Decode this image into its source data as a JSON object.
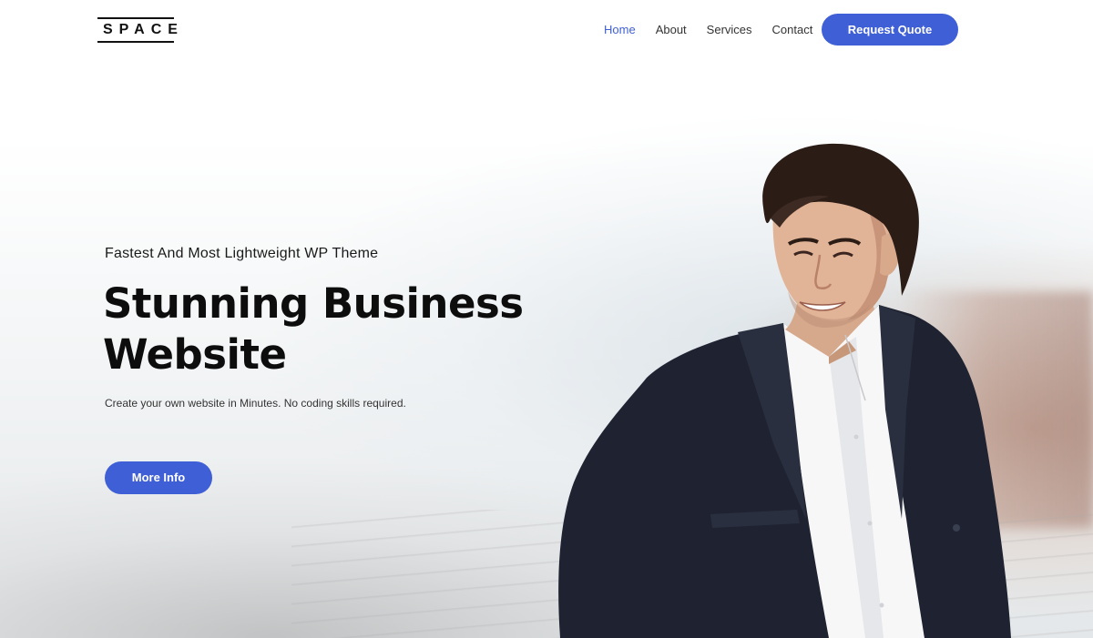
{
  "brand": {
    "logo_text": "SPACE"
  },
  "nav": {
    "items": [
      {
        "label": "Home",
        "active": true
      },
      {
        "label": "About",
        "active": false
      },
      {
        "label": "Services",
        "active": false
      },
      {
        "label": "Contact",
        "active": false
      }
    ],
    "cta_label": "Request Quote"
  },
  "hero": {
    "eyebrow": "Fastest And Most Lightweight WP Theme",
    "headline_line1": "Stunning Business",
    "headline_line2": "Website",
    "subtitle": "Create your own website in Minutes. No coding skills required.",
    "button_label": "More Info"
  },
  "colors": {
    "accent": "#3f5fd6",
    "heading": "#0d0d0d",
    "nav_text": "#333333"
  }
}
